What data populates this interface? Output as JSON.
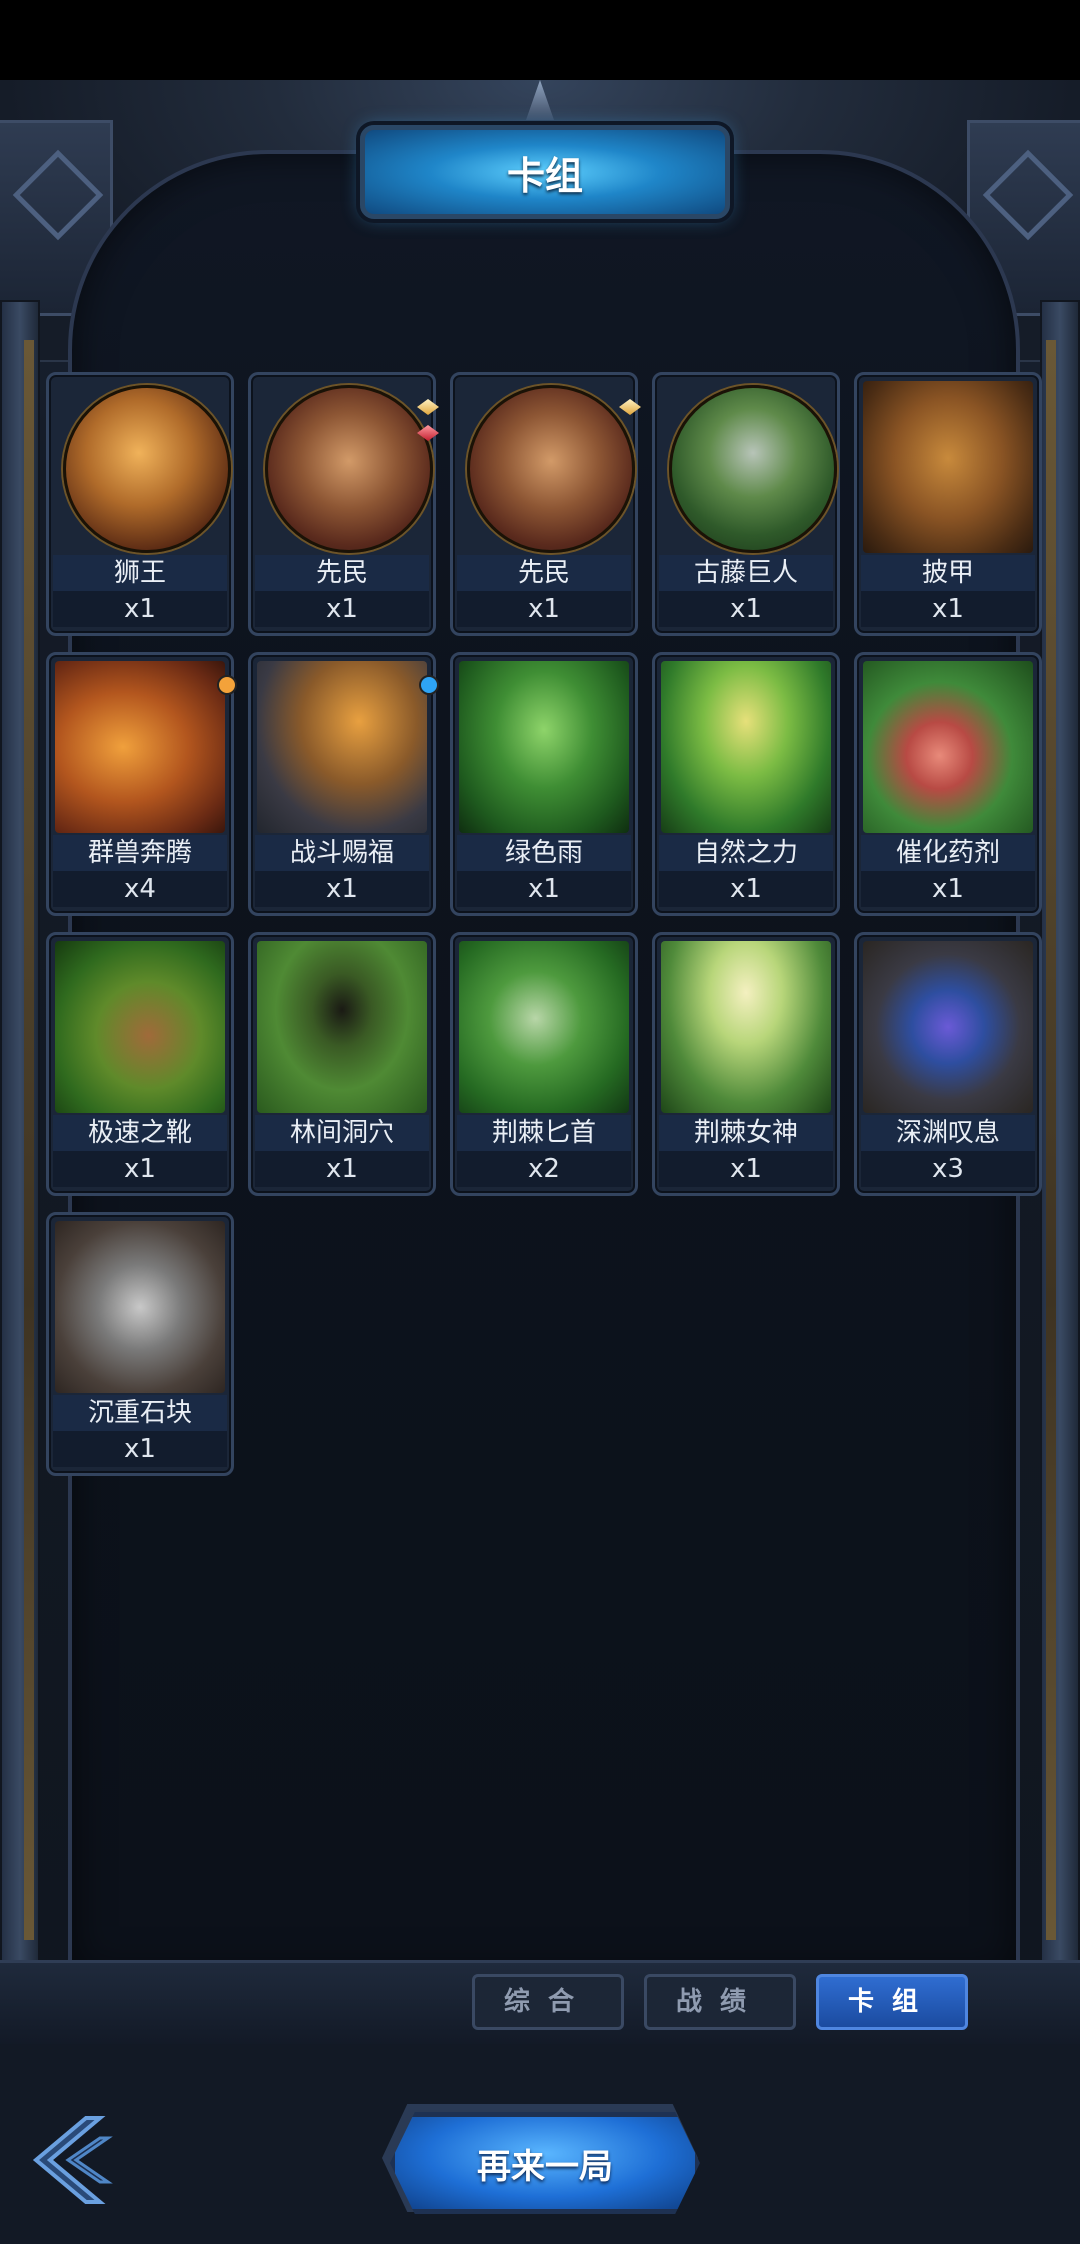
{
  "header": {
    "title": "卡组"
  },
  "cards": [
    {
      "name": "狮王",
      "count": "x1",
      "icon": "lion-king-portrait-icon"
    },
    {
      "name": "先民",
      "count": "x1",
      "icon": "ancestor-warrior-portrait-icon"
    },
    {
      "name": "先民",
      "count": "x1",
      "icon": "ancestor-warrior-portrait-icon"
    },
    {
      "name": "古藤巨人",
      "count": "x1",
      "icon": "vine-giant-portrait-icon"
    },
    {
      "name": "披甲",
      "count": "x1",
      "icon": "armored-beast-icon"
    },
    {
      "name": "群兽奔腾",
      "count": "x4",
      "icon": "stampede-icon"
    },
    {
      "name": "战斗赐福",
      "count": "x1",
      "icon": "battle-blessing-icon"
    },
    {
      "name": "绿色雨",
      "count": "x1",
      "icon": "green-rain-icon"
    },
    {
      "name": "自然之力",
      "count": "x1",
      "icon": "force-of-nature-icon"
    },
    {
      "name": "催化药剂",
      "count": "x1",
      "icon": "catalyst-potion-icon"
    },
    {
      "name": "极速之靴",
      "count": "x1",
      "icon": "speed-boots-icon"
    },
    {
      "name": "林间洞穴",
      "count": "x1",
      "icon": "forest-cave-icon"
    },
    {
      "name": "荆棘匕首",
      "count": "x2",
      "icon": "thorn-dagger-icon"
    },
    {
      "name": "荆棘女神",
      "count": "x1",
      "icon": "thorn-goddess-icon"
    },
    {
      "name": "深渊叹息",
      "count": "x3",
      "icon": "abyss-sigh-icon"
    },
    {
      "name": "沉重石块",
      "count": "x1",
      "icon": "heavy-stone-icon"
    }
  ],
  "tabs": [
    {
      "label": "综合",
      "active": false
    },
    {
      "label": "战绩",
      "active": false
    },
    {
      "label": "卡组",
      "active": true
    }
  ],
  "actions": {
    "replay_label": "再来一局",
    "back_icon": "back-arrow-icon"
  },
  "colors": {
    "accent_blue": "#1e6fd6",
    "card_frame": "#33445f",
    "name_plate": "#1a2a45",
    "gem_gold": "#e0a63c",
    "gem_red": "#c21f2f",
    "dot_orange": "#f3a23a",
    "dot_blue": "#2ea4f5"
  }
}
